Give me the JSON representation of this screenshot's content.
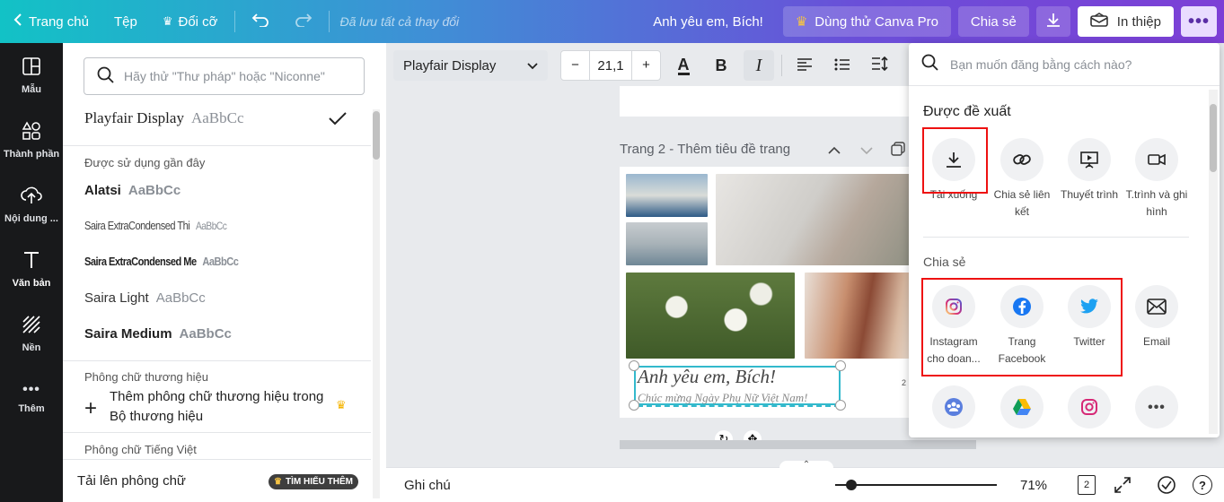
{
  "topbar": {
    "home": "Trang chủ",
    "file": "Tệp",
    "resize": "Đổi cỡ",
    "saved_status": "Đã lưu tất cả thay đổi",
    "design_title": "Anh yêu em, Bích!",
    "try_pro": "Dùng thử Canva Pro",
    "share": "Chia sẻ",
    "print": "In thiệp"
  },
  "leftnav": [
    {
      "label": "Mẫu",
      "icon": "templates-icon"
    },
    {
      "label": "Thành phần",
      "icon": "elements-icon"
    },
    {
      "label": "Nội dung ...",
      "icon": "upload-icon"
    },
    {
      "label": "Văn bản",
      "icon": "text-icon"
    },
    {
      "label": "Nền",
      "icon": "background-icon"
    },
    {
      "label": "Thêm",
      "icon": "more-icon"
    }
  ],
  "fontpanel": {
    "search_placeholder": "Hãy thử \"Thư pháp\" hoặc \"Niconne\"",
    "current_font": "Playfair Display",
    "current_sample": "AaBbCc",
    "recent_label": "Được sử dụng gần đây",
    "recent_fonts": [
      {
        "name": "Alatsi",
        "sample": "AaBbCc"
      },
      {
        "name": "Saira ExtraCondensed Thi",
        "sample": "AaBbCc"
      },
      {
        "name": "Saira ExtraCondensed Me",
        "sample": "AaBbCc"
      },
      {
        "name": "Saira Light",
        "sample": "AaBbCc"
      },
      {
        "name": "Saira Medium",
        "sample": "AaBbCc"
      }
    ],
    "brand_label": "Phông chữ thương hiệu",
    "brand_add_line1": "Thêm phông chữ thương hiệu trong",
    "brand_add_line2": "Bộ thương hiệu",
    "vietnamese_label": "Phông chữ Tiếng Việt",
    "upload_font": "Tải lên phông chữ",
    "learn_more": "TÌM HIỂU THÊM"
  },
  "toolbar": {
    "font_family": "Playfair Display",
    "font_size": "21,1"
  },
  "canvas": {
    "page_title": "Trang 2 - Thêm tiêu đề trang",
    "heading_text": "Anh yêu em, Bích!",
    "sub_text": "Chúc mừng Ngày Phụ Nữ Việt Nam!",
    "side_text": "2"
  },
  "bottombar": {
    "notes": "Ghi chú",
    "zoom": "71%",
    "page_count": "2",
    "zoom_fraction": 0.1
  },
  "share_panel": {
    "search_placeholder": "Bạn muốn đăng bằng cách nào?",
    "suggested_heading": "Được đề xuất",
    "suggested": [
      {
        "label": "Tải xuống",
        "icon": "download-icon"
      },
      {
        "label": "Chia sẻ liên kết",
        "icon": "link-icon"
      },
      {
        "label": "Thuyết trình",
        "icon": "present-icon"
      },
      {
        "label": "T.trình và ghi hình",
        "icon": "record-icon"
      }
    ],
    "share_heading": "Chia sẻ",
    "share_items": [
      {
        "label": "Instagram cho doan...",
        "icon": "instagram-icon"
      },
      {
        "label": "Trang Facebook",
        "icon": "facebook-icon"
      },
      {
        "label": "Twitter",
        "icon": "twitter-icon"
      },
      {
        "label": "Email",
        "icon": "email-icon"
      }
    ],
    "more_items": [
      "group-icon",
      "google-drive-icon",
      "instagram-icon",
      "more-icon"
    ]
  },
  "colors": {
    "accent_red": "#e11111",
    "facebook": "#1877f2",
    "twitter": "#1da1f2",
    "selection": "#33b9cc"
  }
}
